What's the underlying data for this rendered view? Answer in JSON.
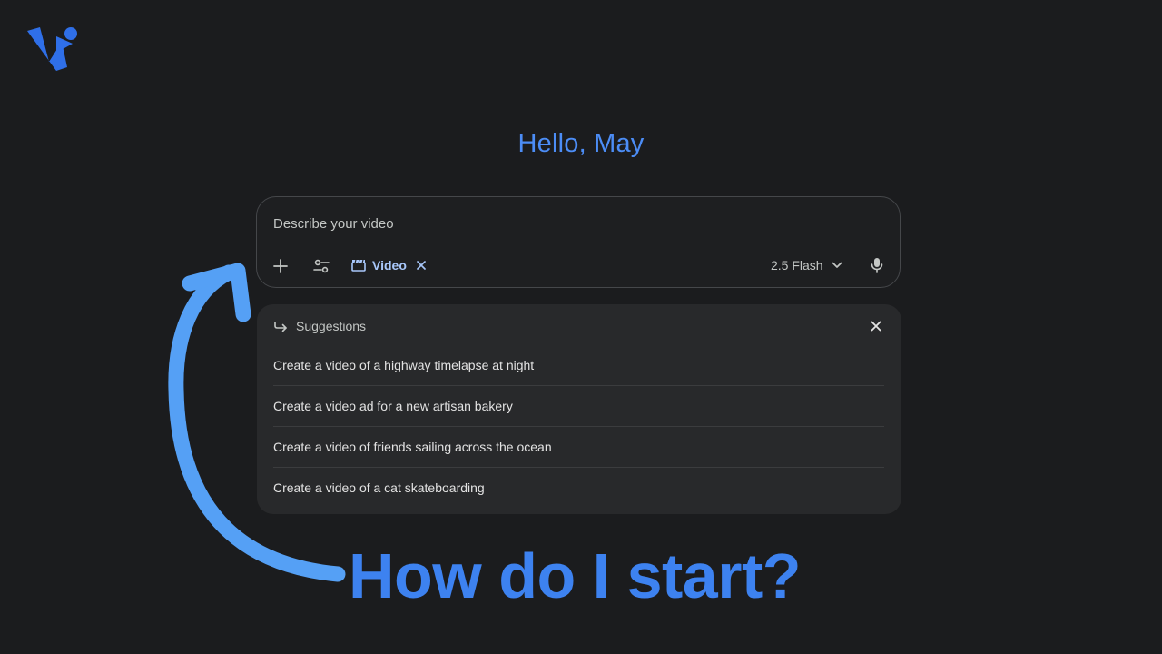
{
  "colors": {
    "background": "#1b1c1e",
    "accent_blue": "#4c8df6",
    "chip_blue": "#a8c7fa",
    "arrow_blue": "#55a0f5",
    "caption_blue": "#3d82f0",
    "logo_blue": "#2f6fe8"
  },
  "logo": {
    "icon": "vidnoz-logo-icon"
  },
  "greeting": "Hello, May",
  "prompt": {
    "placeholder": "Describe your video",
    "value": "",
    "add_icon": "plus-icon",
    "tools_icon": "tune-icon",
    "video_chip": {
      "icon": "clapperboard-icon",
      "label": "Video",
      "close_icon": "close-icon"
    },
    "model": {
      "label": "2.5 Flash",
      "icon": "chevron-down-icon"
    },
    "mic_icon": "microphone-icon"
  },
  "suggestions": {
    "title": "Suggestions",
    "header_icon": "arrow-forward-icon",
    "close_icon": "close-icon",
    "items": [
      "Create a video of a highway timelapse at night",
      "Create a video ad for a new artisan bakery",
      "Create a video of friends sailing across the ocean",
      "Create a video of a cat skateboarding"
    ]
  },
  "caption": "How do I start?"
}
